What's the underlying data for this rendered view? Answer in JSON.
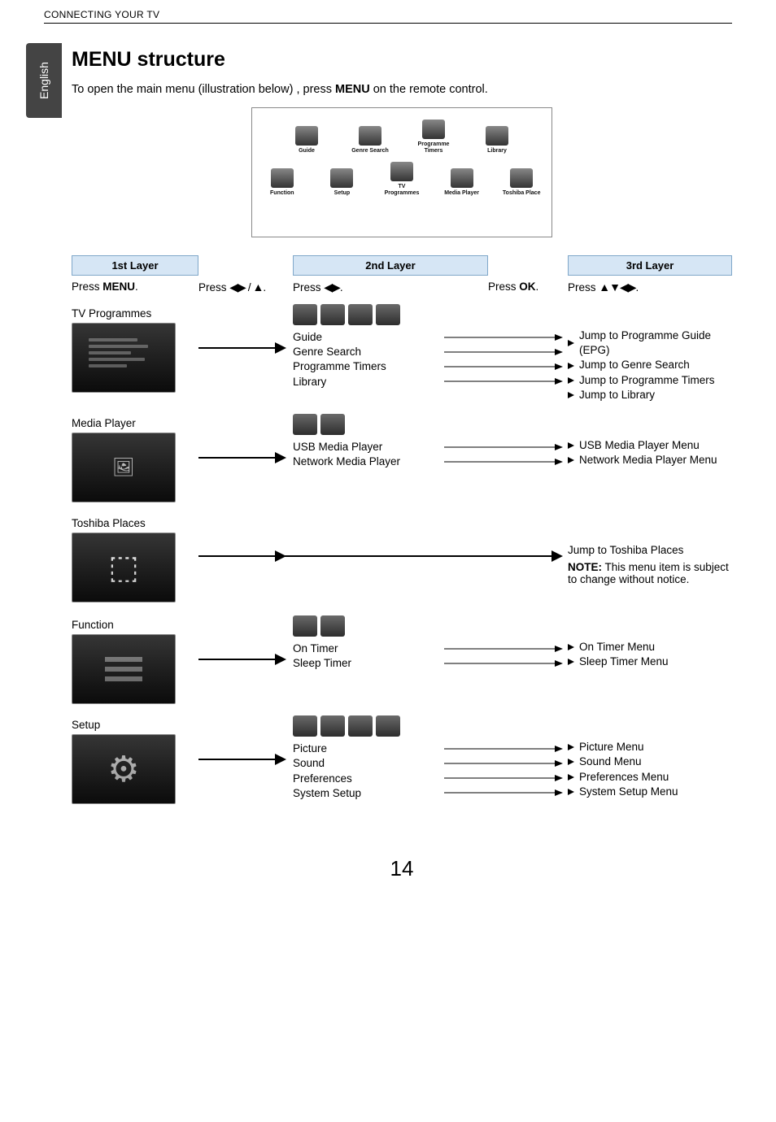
{
  "running_head": "CONNECTING YOUR TV",
  "language_tab": "English",
  "title": "MENU structure",
  "intro_pre": "To open the main menu (illustration below) , press ",
  "intro_bold": "MENU",
  "intro_post": " on the remote control.",
  "illus_icons": {
    "row1": [
      "Guide",
      "Genre Search",
      "Programme Timers",
      "Library"
    ],
    "row2": [
      "Function",
      "Setup",
      "TV Programmes",
      "Media Player",
      "Toshiba Place"
    ]
  },
  "layers": {
    "h1": "1st Layer",
    "h2": "2nd Layer",
    "h3": "3rd Layer",
    "press1_pre": "Press ",
    "press1_bold": "MENU",
    "press1_post": ".",
    "press12_pre": "Press ",
    "press12_glyph": "◀▶ / ▲",
    "press12_post": ".",
    "press2_pre": "Press ",
    "press2_glyph": "◀▶",
    "press2_post": ".",
    "press23_pre": "Press ",
    "press23_bold": "OK",
    "press23_post": ".",
    "press3_pre": "Press ",
    "press3_glyph": "▲▼◀▶",
    "press3_post": "."
  },
  "rows": [
    {
      "label": "TV Programmes",
      "thumb_kind": "lines",
      "sub_icons": 4,
      "sub_items": [
        "Guide",
        "Genre Search",
        "Programme Timers",
        "Library"
      ],
      "results": [
        "Jump to Programme Guide (EPG)",
        "Jump to Genre Search",
        "Jump to Programme Timers",
        "Jump to Library"
      ]
    },
    {
      "label": "Media Player",
      "thumb_kind": "photo",
      "sub_icons": 2,
      "sub_items": [
        "USB Media Player",
        "Network Media Player"
      ],
      "results": [
        "USB Media Player Menu",
        "Network Media Player Menu"
      ]
    },
    {
      "label": "Toshiba Places",
      "thumb_kind": "places",
      "sub_icons": 0,
      "sub_items": [],
      "results_plain": "Jump to Toshiba Places",
      "note_bold": "NOTE:",
      "note_rest": " This menu item is subject to change without notice."
    },
    {
      "label": "Function",
      "thumb_kind": "bars",
      "sub_icons": 2,
      "sub_items": [
        "On Timer",
        "Sleep Timer"
      ],
      "results": [
        "On Timer Menu",
        "Sleep Timer Menu"
      ]
    },
    {
      "label": "Setup",
      "thumb_kind": "gear",
      "sub_icons": 4,
      "sub_items": [
        "Picture",
        "Sound",
        "Preferences",
        "System Setup"
      ],
      "results": [
        "Picture Menu",
        "Sound Menu",
        "Preferences Menu",
        "System Setup Menu"
      ]
    }
  ],
  "page_number": "14"
}
